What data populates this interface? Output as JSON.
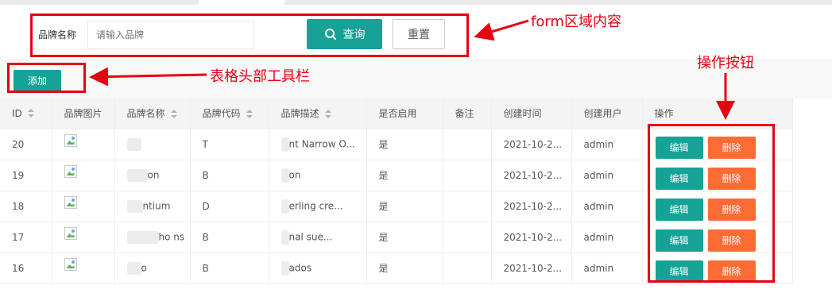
{
  "form": {
    "label": "品牌名称",
    "input_placeholder": "请输入品牌",
    "query_label": "查询",
    "reset_label": "重置"
  },
  "toolbar": {
    "add_label": "添加"
  },
  "table": {
    "headers": [
      "ID",
      "品牌图片",
      "品牌名称",
      "品牌代码",
      "品牌描述",
      "是否启用",
      "备注",
      "创建时间",
      "创建用户",
      "操作"
    ],
    "sortable": [
      true,
      false,
      true,
      true,
      true,
      false,
      false,
      false,
      false,
      false
    ],
    "rows": [
      {
        "id": "20",
        "name": "",
        "code": "T",
        "desc": "nt Narrow O...",
        "enabled": "是",
        "remark": "",
        "created": "2021-10-2...",
        "user": "admin"
      },
      {
        "id": "19",
        "name": "on",
        "code": "B",
        "desc": "on",
        "enabled": "是",
        "remark": "",
        "created": "2021-10-2...",
        "user": "admin"
      },
      {
        "id": "18",
        "name": "ntium",
        "code": "D",
        "desc": "erling cre...",
        "enabled": "是",
        "remark": "",
        "created": "2021-10-2...",
        "user": "admin"
      },
      {
        "id": "17",
        "name": "ho ns",
        "code": "B",
        "desc": "nal sue...",
        "enabled": "是",
        "remark": "",
        "created": "2021-10-2...",
        "user": "admin"
      },
      {
        "id": "16",
        "name": "o",
        "code": "B",
        "desc": "ados",
        "enabled": "是",
        "remark": "",
        "created": "2021-10-2...",
        "user": "admin"
      }
    ],
    "edit_label": "编辑",
    "delete_label": "删除"
  },
  "annotations": {
    "form_note": "form区域内容",
    "toolbar_note": "表格头部工具栏",
    "ops_note": "操作按钮",
    "color": "#e60012"
  },
  "colors": {
    "primary": "#16a296",
    "danger": "#ff6b35"
  }
}
